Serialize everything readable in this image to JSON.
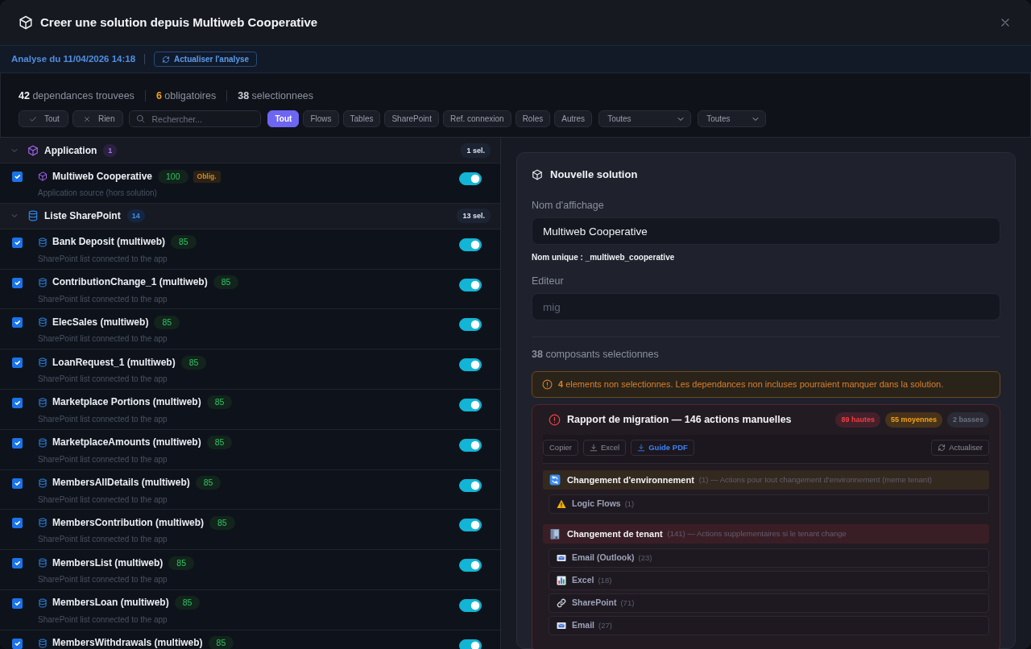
{
  "window": {
    "title": "Creer une solution depuis Multiweb Cooperative"
  },
  "analysis_bar": {
    "text": "Analyse du 11/04/2026 14:18",
    "refresh_button": "Actualiser l'analyse"
  },
  "stats": [
    {
      "text": "**42** dependances trouvees",
      "kind": "total"
    },
    {
      "text": "**6** obligatoires",
      "kind": "required"
    },
    {
      "text": "**38** selectionnees",
      "kind": "selected"
    }
  ],
  "toolbar": {
    "select_actions": [
      {
        "label": "Tout",
        "kind": "all"
      },
      {
        "label": "Rien",
        "kind": "none"
      }
    ],
    "search": {
      "placeholder": "Rechercher..."
    },
    "type_filters": [
      {
        "label": "Tout",
        "selected": true
      },
      {
        "label": "Flows",
        "selected": false
      },
      {
        "label": "Tables",
        "selected": false
      },
      {
        "label": "SharePoint",
        "selected": false
      },
      {
        "label": "Ref. connexion",
        "selected": false
      },
      {
        "label": "Roles",
        "selected": false
      },
      {
        "label": "Autres",
        "selected": false
      }
    ],
    "dropdowns": [
      {
        "value": "Toutes"
      },
      {
        "value": "Toutes"
      }
    ]
  },
  "groups": [
    {
      "kind": "app",
      "title": "Application",
      "count": "1",
      "selection": "1 sel.",
      "expanded": true,
      "items": [
        {
          "name": "Multiweb Cooperative",
          "score": "100",
          "required_badge": "Oblig.",
          "description": "Application source (hors solution)",
          "checked": true,
          "on": true
        }
      ]
    },
    {
      "kind": "sharepoint",
      "title": "Liste SharePoint",
      "count": "14",
      "selection": "13 sel.",
      "expanded": true,
      "items": [
        {
          "name": "Bank Deposit (multiweb)",
          "score": "85",
          "description": "SharePoint list connected to the app",
          "checked": true,
          "on": true
        },
        {
          "name": "ContributionChange_1 (multiweb)",
          "score": "85",
          "description": "SharePoint list connected to the app",
          "checked": true,
          "on": true
        },
        {
          "name": "ElecSales (multiweb)",
          "score": "85",
          "description": "SharePoint list connected to the app",
          "checked": true,
          "on": true
        },
        {
          "name": "LoanRequest_1 (multiweb)",
          "score": "85",
          "description": "SharePoint list connected to the app",
          "checked": true,
          "on": true
        },
        {
          "name": "Marketplace Portions (multiweb)",
          "score": "85",
          "description": "SharePoint list connected to the app",
          "checked": true,
          "on": true
        },
        {
          "name": "MarketplaceAmounts (multiweb)",
          "score": "85",
          "description": "SharePoint list connected to the app",
          "checked": true,
          "on": true
        },
        {
          "name": "MembersAllDetails (multiweb)",
          "score": "85",
          "description": "SharePoint list connected to the app",
          "checked": true,
          "on": true
        },
        {
          "name": "MembersContribution (multiweb)",
          "score": "85",
          "description": "SharePoint list connected to the app",
          "checked": true,
          "on": true
        },
        {
          "name": "MembersList (multiweb)",
          "score": "85",
          "description": "SharePoint list connected to the app",
          "checked": true,
          "on": true
        },
        {
          "name": "MembersLoan (multiweb)",
          "score": "85",
          "description": "SharePoint list connected to the app",
          "checked": true,
          "on": true
        },
        {
          "name": "MembersWithdrawals (multiweb)",
          "score": "85",
          "checked": true,
          "on": true
        }
      ]
    }
  ],
  "solution_form": {
    "title": "Nouvelle solution",
    "display_name": {
      "label": "Nom d'affichage",
      "value": "Multiweb Cooperative"
    },
    "unique_name": "Nom unique : _multiweb_cooperative",
    "publisher": {
      "label": "Editeur",
      "placeholder": "mig"
    },
    "summary": "**38** composants selectionnes",
    "warning": "**4** elements non selectionnes. Les dependances non incluses pourraient manquer dans la solution."
  },
  "migration_report": {
    "title": "Rapport de migration — 146 actions manuelles",
    "severity_badges": [
      {
        "label": "89 hautes",
        "kind": "high"
      },
      {
        "label": "55 moyennes",
        "kind": "medium"
      },
      {
        "label": "2 basses",
        "kind": "low"
      }
    ],
    "actions": [
      {
        "label": "Copier",
        "kind": "plain"
      },
      {
        "label": "Excel",
        "kind": "download"
      },
      {
        "label": "Guide PDF",
        "kind": "primary-download"
      }
    ],
    "refresh_button": "Actualiser",
    "sections": [
      {
        "kind": "environment",
        "title": "Changement d'environnement",
        "detail": "(1) — Actions pour tout changement d'environnement (meme tenant)",
        "items": [
          {
            "kind": "warning",
            "label": "Logic Flows",
            "count": "(1)"
          }
        ]
      },
      {
        "kind": "tenant",
        "title": "Changement de tenant",
        "detail": "(141) — Actions supplementaires si le tenant change",
        "items": [
          {
            "kind": "email",
            "label": "Email (Outlook)",
            "count": "(23)"
          },
          {
            "kind": "chart",
            "label": "Excel",
            "count": "(18)"
          },
          {
            "kind": "link",
            "label": "SharePoint",
            "count": "(71)"
          },
          {
            "kind": "email",
            "label": "Email",
            "count": "(27)"
          }
        ]
      }
    ]
  }
}
